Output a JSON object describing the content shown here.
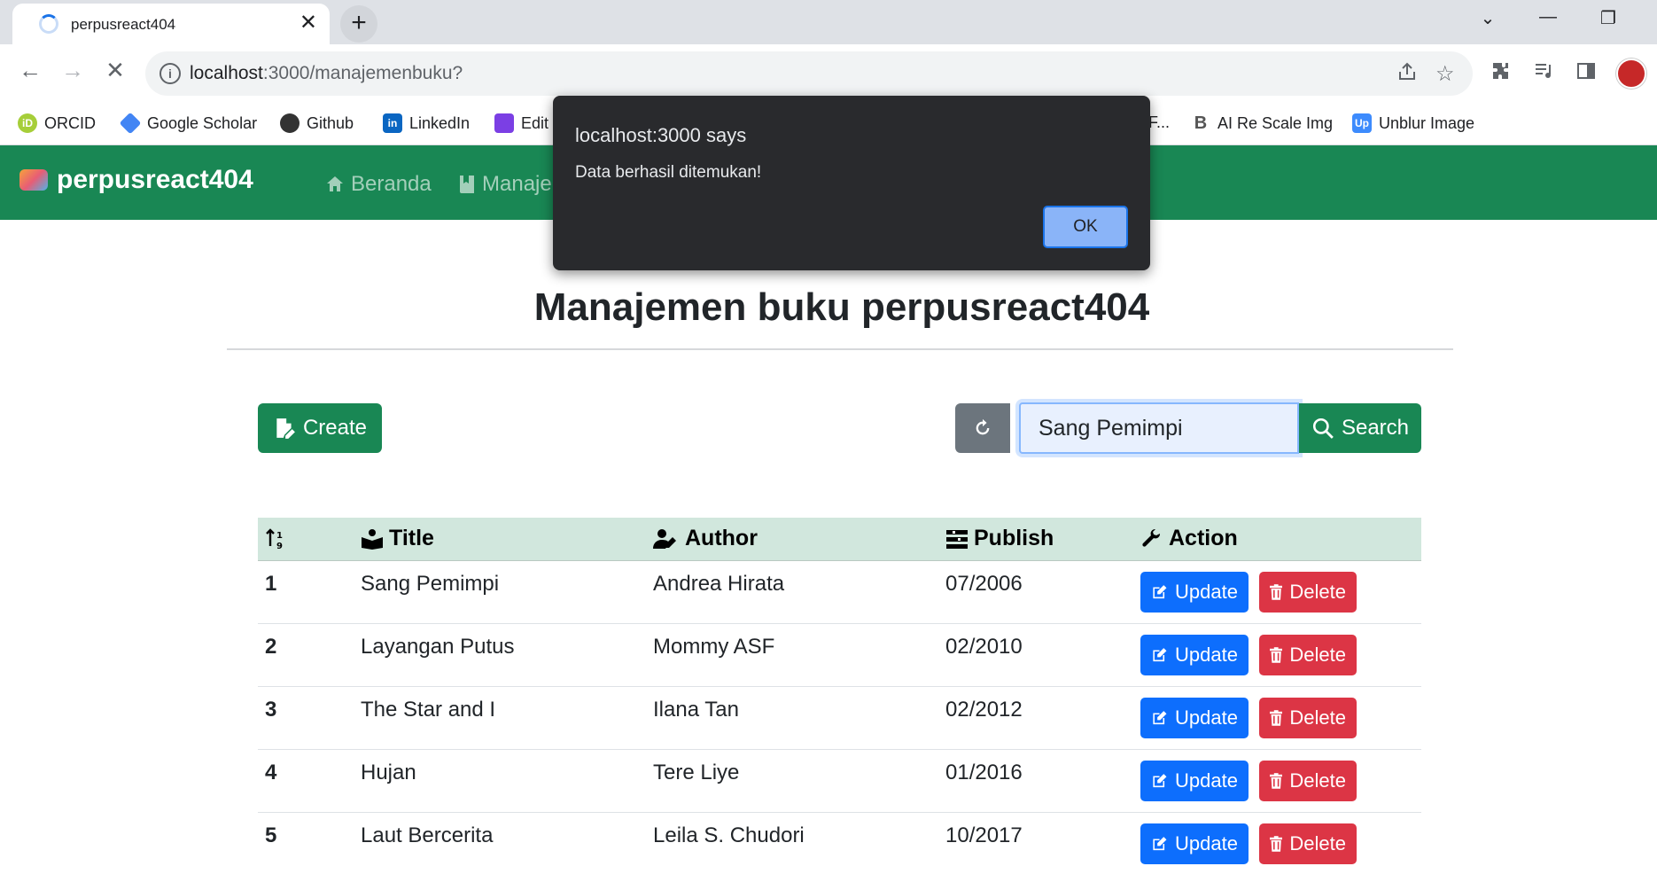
{
  "browser": {
    "tab_title": "perpusreact404",
    "tab_close": "✕",
    "new_tab": "+",
    "url_host": "localhost",
    "url_path": ":3000/manajemenbuku?",
    "bookmarks": [
      {
        "label": "ORCID",
        "icon": "orcid-icon",
        "color": "#a6ce39"
      },
      {
        "label": "Google Scholar",
        "icon": "scholar-icon",
        "color": "#4285f4"
      },
      {
        "label": "Github",
        "icon": "github-icon",
        "color": "#333333"
      },
      {
        "label": "LinkedIn",
        "icon": "linkedin-icon",
        "color": "#0a66c2"
      },
      {
        "label": "Edit",
        "icon": "edit-icon",
        "color": "#7b3fe4"
      },
      {
        "label": "F...",
        "icon": "",
        "color": ""
      },
      {
        "label": "AI Re Scale Img",
        "icon": "b-icon",
        "color": "#555555"
      },
      {
        "label": "Unblur Image",
        "icon": "up-icon",
        "color": "#3d8bfd"
      }
    ]
  },
  "navbar": {
    "brand": "perpusreact404",
    "links": [
      "Beranda",
      "Manaje"
    ],
    "bg_color": "#198754"
  },
  "page": {
    "title": "Manajemen buku perpusreact404",
    "create_label": "Create",
    "search_value": "Sang Pemimpi",
    "search_label": "Search"
  },
  "table": {
    "headers": [
      "",
      "Title",
      "Author",
      "Publish",
      "Action"
    ],
    "rows": [
      {
        "no": "1",
        "title": "Sang Pemimpi",
        "author": "Andrea Hirata",
        "publish": "07/2006"
      },
      {
        "no": "2",
        "title": "Layangan Putus",
        "author": "Mommy ASF",
        "publish": "02/2010"
      },
      {
        "no": "3",
        "title": "The Star and I",
        "author": "Ilana Tan",
        "publish": "02/2012"
      },
      {
        "no": "4",
        "title": "Hujan",
        "author": "Tere Liye",
        "publish": "01/2016"
      },
      {
        "no": "5",
        "title": "Laut Bercerita",
        "author": "Leila S. Chudori",
        "publish": "10/2017"
      }
    ],
    "update_label": "Update",
    "delete_label": "Delete"
  },
  "dialog": {
    "title": "localhost:3000 says",
    "message": "Data berhasil ditemukan!",
    "ok_label": "OK"
  }
}
